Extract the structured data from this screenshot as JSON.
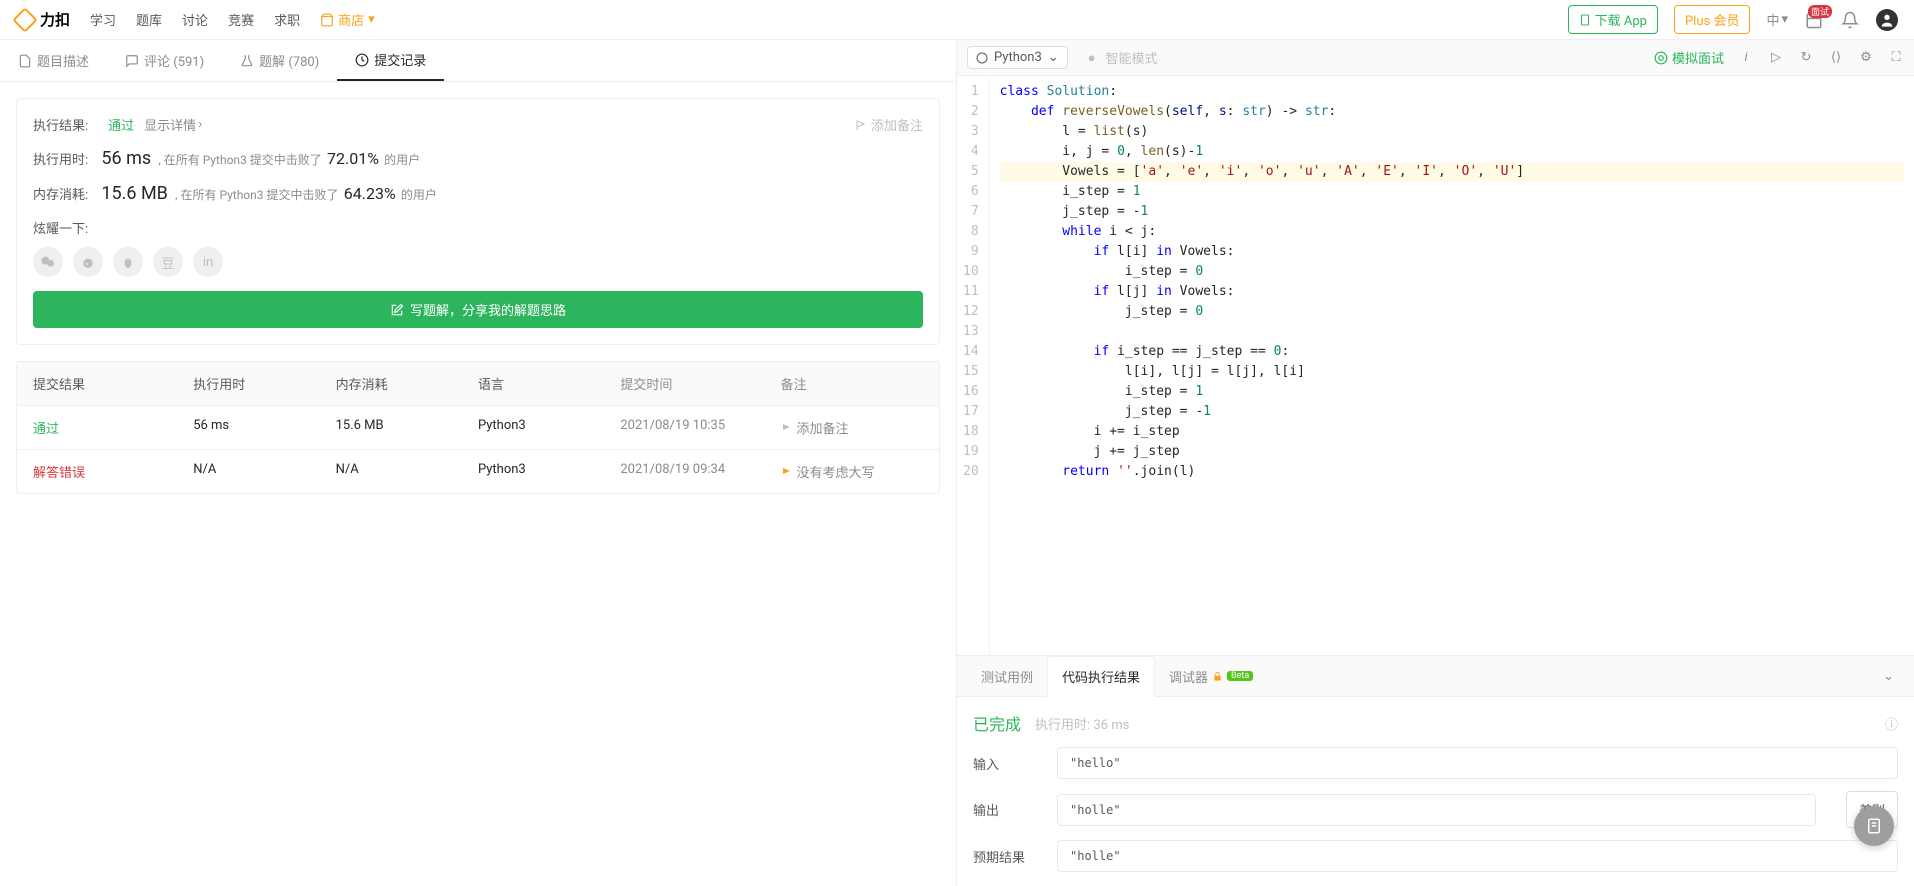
{
  "topbar": {
    "logo_text": "力扣",
    "nav": [
      "学习",
      "题库",
      "讨论",
      "竞赛",
      "求职"
    ],
    "shop": "商店",
    "download": "下载 App",
    "plus": "Plus 会员",
    "lang": "中",
    "badge": "面试"
  },
  "left_tabs": [
    {
      "icon": "desc",
      "label": "题目描述"
    },
    {
      "icon": "comment",
      "label": "评论 (591)"
    },
    {
      "icon": "solution",
      "label": "题解 (780)"
    },
    {
      "icon": "history",
      "label": "提交记录"
    }
  ],
  "result": {
    "label": "执行结果:",
    "status": "通过",
    "detail_link": "显示详情",
    "addnote": "添加备注",
    "time_label": "执行用时:",
    "time_val": "56 ms",
    "time_desc_pre": ", 在所有 Python3 提交中击败了",
    "time_pct": "72.01%",
    "time_desc_post": "的用户",
    "mem_label": "内存消耗:",
    "mem_val": "15.6 MB",
    "mem_desc_pre": ", 在所有 Python3 提交中击败了",
    "mem_pct": "64.23%",
    "mem_desc_post": "的用户",
    "share_label": "炫耀一下:",
    "write_btn": "写题解，分享我的解题思路"
  },
  "table": {
    "headers": [
      "提交结果",
      "执行用时",
      "内存消耗",
      "语言",
      "提交时间",
      "备注"
    ],
    "rows": [
      {
        "result": "通过",
        "result_class": "pass",
        "time": "56 ms",
        "memory": "15.6 MB",
        "lang": "Python3",
        "date": "2021/08/19 10:35",
        "note": "添加备注",
        "note_icon": "flag-gray"
      },
      {
        "result": "解答错误",
        "result_class": "fail",
        "time": "N/A",
        "memory": "N/A",
        "lang": "Python3",
        "date": "2021/08/19 09:34",
        "note": "没有考虑大写",
        "note_icon": "flag-yellow"
      }
    ]
  },
  "editor": {
    "language": "Python3",
    "ai_mode": "智能模式",
    "mock": "模拟面试",
    "code_lines": [
      {
        "n": 1,
        "html": "<span class='kw'>class</span> <span class='cls'>Solution</span>:"
      },
      {
        "n": 2,
        "html": "    <span class='kw'>def</span> <span class='fn'>reverseVowels</span>(<span class='var'>self</span>, <span class='var'>s</span>: <span class='cls'>str</span>) -&gt; <span class='cls'>str</span>:"
      },
      {
        "n": 3,
        "html": "        l = <span class='fn'>list</span>(s)"
      },
      {
        "n": 4,
        "html": "        i, j = <span class='num'>0</span>, <span class='fn'>len</span>(s)-<span class='num'>1</span>"
      },
      {
        "n": 5,
        "highlight": true,
        "html": "        Vowels = [<span class='str'>'a'</span>, <span class='str'>'e'</span>, <span class='str'>'i'</span>, <span class='str'>'o'</span>, <span class='str'>'u'</span>, <span class='str'>'A'</span>, <span class='str'>'E'</span>, <span class='str'>'I'</span>, <span class='str'>'O'</span>, <span class='str'>'U'</span>]"
      },
      {
        "n": 6,
        "html": "        i_step = <span class='num'>1</span>"
      },
      {
        "n": 7,
        "html": "        j_step = -<span class='num'>1</span>"
      },
      {
        "n": 8,
        "html": "        <span class='kw'>while</span> i &lt; j:"
      },
      {
        "n": 9,
        "html": "            <span class='kw'>if</span> l[i] <span class='kw'>in</span> Vowels:"
      },
      {
        "n": 10,
        "html": "                i_step = <span class='num'>0</span>"
      },
      {
        "n": 11,
        "html": "            <span class='kw'>if</span> l[j] <span class='kw'>in</span> Vowels:"
      },
      {
        "n": 12,
        "html": "                j_step = <span class='num'>0</span>"
      },
      {
        "n": 13,
        "html": ""
      },
      {
        "n": 14,
        "html": "            <span class='kw'>if</span> i_step == j_step == <span class='num'>0</span>:"
      },
      {
        "n": 15,
        "html": "                l[i], l[j] = l[j], l[i]"
      },
      {
        "n": 16,
        "html": "                i_step = <span class='num'>1</span>"
      },
      {
        "n": 17,
        "html": "                j_step = -<span class='num'>1</span>"
      },
      {
        "n": 18,
        "html": "            i += i_step"
      },
      {
        "n": 19,
        "html": "            j += j_step"
      },
      {
        "n": 20,
        "html": "        <span class='kw'>return</span> <span class='str'>''</span>.join(l)"
      }
    ]
  },
  "bottom": {
    "tabs": [
      "测试用例",
      "代码执行结果"
    ],
    "debugger": "调试器",
    "beta": "Beta",
    "status": "已完成",
    "time_label": "执行用时:",
    "time_val": "36 ms",
    "input_label": "输入",
    "input_val": "\"hello\"",
    "output_label": "输出",
    "output_val": "\"holle\"",
    "expected_label": "预期结果",
    "expected_val": "\"holle\"",
    "diff": "差别"
  }
}
